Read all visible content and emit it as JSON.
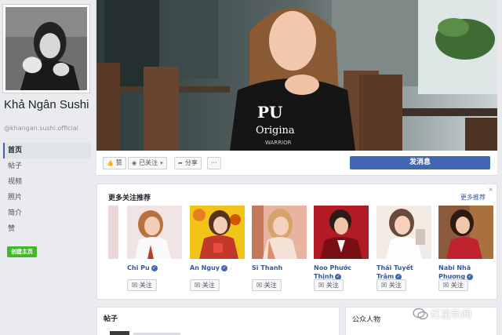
{
  "profile": {
    "name": "Khả Ngân Sushi",
    "handle": "@khangan.sushi.official"
  },
  "sidebar": {
    "items": [
      {
        "label": "首页",
        "active": true
      },
      {
        "label": "帖子"
      },
      {
        "label": "视频"
      },
      {
        "label": "照片"
      },
      {
        "label": "简介"
      },
      {
        "label": "赞"
      }
    ],
    "create_label": "创建主页"
  },
  "cover": {
    "sweater_text": "PU",
    "sweater_text2": "Origina",
    "sweater_text3": "WARRIOR"
  },
  "actions": {
    "like": "赞",
    "following": "已关注",
    "share": "分享",
    "more": "···",
    "send_message": "发消息"
  },
  "recommendations": {
    "title": "更多关注推荐",
    "more_link": "更多推荐",
    "close": "×",
    "follow_label": "关注",
    "items": [
      {
        "name": "Chi Pu",
        "verified": true
      },
      {
        "name": "An Nguy",
        "verified": true
      },
      {
        "name": "Sĩ Thanh",
        "verified": false
      },
      {
        "name": "Noo Phước Thịnh",
        "verified": true
      },
      {
        "name": "Thái Tuyết Trâm",
        "verified": true
      },
      {
        "name": "Nabi Nhã Phương",
        "verified": true
      }
    ]
  },
  "bottom": {
    "posts_title": "帖子",
    "public_figure": "公众人物"
  },
  "watermark": {
    "text": "红星新闻"
  },
  "colors": {
    "accent": "#4267b2",
    "green": "#42b72a",
    "background": "#e9ebee"
  }
}
